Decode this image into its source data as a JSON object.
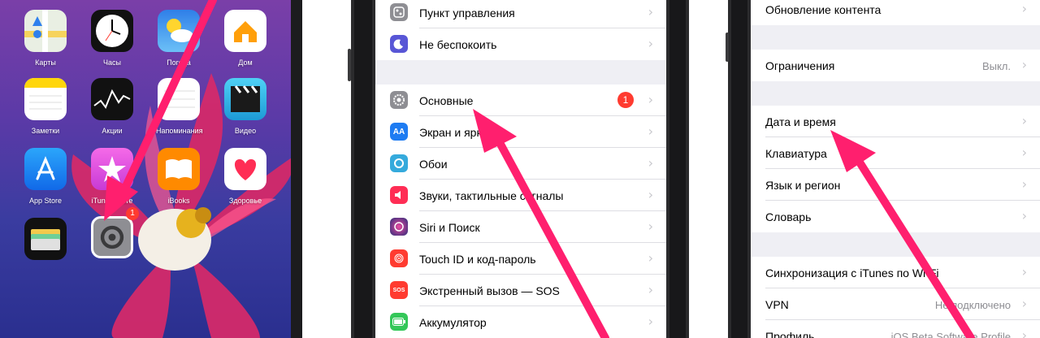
{
  "home": {
    "apps": [
      {
        "name": "Карты",
        "color": "#e9efe3",
        "glyph": "maps"
      },
      {
        "name": "Часы",
        "color": "#111111",
        "glyph": "clock"
      },
      {
        "name": "Погода",
        "color": "#3fa3f2",
        "glyph": "weather"
      },
      {
        "name": "Дом",
        "color": "#ffffff",
        "glyph": "home"
      },
      {
        "name": "Заметки",
        "color": "#ffffff",
        "glyph": "notes"
      },
      {
        "name": "Акции",
        "color": "#111111",
        "glyph": "stocks"
      },
      {
        "name": "Напоминания",
        "color": "#ffffff",
        "glyph": "reminders"
      },
      {
        "name": "Видео",
        "color": "#2ab7e8",
        "glyph": "video"
      },
      {
        "name": "App Store",
        "color": "#1e8ff0",
        "glyph": "appstore"
      },
      {
        "name": "iTunes Store",
        "color": "#e84fd8",
        "glyph": "star"
      },
      {
        "name": "iBooks",
        "color": "#ff8a00",
        "glyph": "book"
      },
      {
        "name": "Здоровье",
        "color": "#ffffff",
        "glyph": "heart"
      },
      {
        "name": "Wallet",
        "color": "#111111",
        "glyph": "wallet"
      },
      {
        "name": "Настройки",
        "color": "#8e8e93",
        "glyph": "gear"
      }
    ],
    "settings_badge": "1"
  },
  "screen2": {
    "rows": [
      {
        "label": "Пункт управления",
        "icon": "control-center-icon",
        "color": "#8e8e93"
      },
      {
        "label": "Не беспокоить",
        "icon": "moon-icon",
        "color": "#5856d6"
      },
      {
        "label": "Основные",
        "icon": "gear-icon",
        "color": "#8e8e93",
        "badge": "1"
      },
      {
        "label": "Экран и яркость",
        "icon": "display-icon",
        "color": "#1e7cf2"
      },
      {
        "label": "Обои",
        "icon": "wallpaper-icon",
        "color": "#35aadc"
      },
      {
        "label": "Звуки, тактильные сигналы",
        "icon": "sound-icon",
        "color": "#ff2d55"
      },
      {
        "label": "Siri и Поиск",
        "icon": "siri-icon",
        "color": "#2c2c7a"
      },
      {
        "label": "Touch ID и код-пароль",
        "icon": "fingerprint-icon",
        "color": "#ff3b30"
      },
      {
        "label": "Экстренный вызов — SOS",
        "icon": "sos-icon",
        "color": "#ff3b30"
      },
      {
        "label": "Аккумулятор",
        "icon": "battery-icon",
        "color": "#34c759"
      }
    ]
  },
  "screen3": {
    "rows": [
      {
        "label": "Обновление контента",
        "value": ""
      },
      {
        "label": "Ограничения",
        "value": "Выкл."
      },
      {
        "label": "Дата и время",
        "value": ""
      },
      {
        "label": "Клавиатура",
        "value": ""
      },
      {
        "label": "Язык и регион",
        "value": ""
      },
      {
        "label": "Словарь",
        "value": ""
      },
      {
        "label": "Синхронизация с iTunes по Wi-Fi",
        "value": ""
      },
      {
        "label": "VPN",
        "value": "Не подключено"
      },
      {
        "label": "Профиль",
        "value": "iOS Beta Software Profile"
      }
    ]
  },
  "colors": {
    "arrow": "#ff1f6e",
    "group_bg": "#efeff4"
  }
}
